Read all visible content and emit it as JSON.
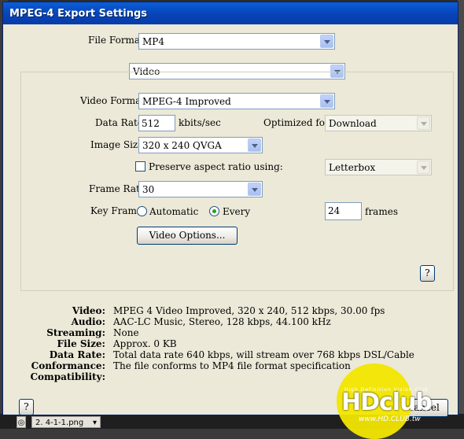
{
  "window": {
    "title": "MPEG-4 Export Settings"
  },
  "format": {
    "label": "File Format:",
    "value": "MP4"
  },
  "section": {
    "value": "Video"
  },
  "video": {
    "format_label": "Video Format:",
    "format_value": "MPEG-4 Improved",
    "data_rate_label": "Data Rate:",
    "data_rate_value": "512",
    "data_rate_unit": "kbits/sec",
    "optimized_label": "Optimized for:",
    "optimized_value": "Download",
    "image_size_label": "Image Size:",
    "image_size_value": "320 x 240 QVGA",
    "preserve_label": "Preserve aspect ratio using:",
    "preserve_checked": false,
    "preserve_value": "Letterbox",
    "frame_rate_label": "Frame Rate:",
    "frame_rate_value": "30",
    "key_frame_label": "Key Frame:",
    "key_frame_auto": "Automatic",
    "key_frame_every": "Every",
    "key_frame_selected": "Every",
    "key_frame_count": "24",
    "key_frame_unit": "frames",
    "options_button": "Video Options...",
    "help": "?"
  },
  "summary": [
    {
      "label": "Video:",
      "value": "MPEG 4 Video Improved, 320 x 240, 512 kbps, 30.00 fps"
    },
    {
      "label": "Audio:",
      "value": "AAC-LC Music, Stereo, 128 kbps, 44.100 kHz"
    },
    {
      "label": "Streaming:",
      "value": "None"
    },
    {
      "label": "File Size:",
      "value": "Approx. 0 KB"
    },
    {
      "label": "Data Rate:",
      "value": "Total data rate 640 kbps, will stream over 768 kbps DSL/Cable"
    },
    {
      "label": "Conformance:",
      "value": "The file conforms to MP4 file format specification"
    },
    {
      "label": "Compatibility:",
      "value": ""
    }
  ],
  "footer": {
    "help": "?",
    "cancel": "Cancel"
  },
  "taskbar": {
    "item": "2. 4-1-1.png"
  },
  "watermark": {
    "tagline": "High Definition Vision Club",
    "logo": "HDclub",
    "url": "www.HD.CLUB.tw"
  },
  "colors": {
    "titlebar": "#0a5ed7",
    "dialog": "#ece9d8",
    "watermark": "#f2e600"
  }
}
